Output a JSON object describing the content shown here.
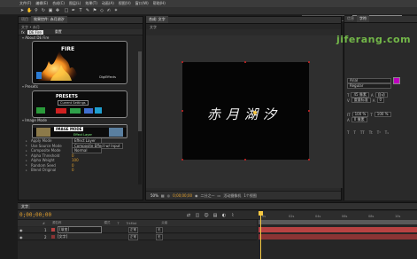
{
  "menubar": {
    "items": [
      "文件(F)",
      "编辑(E)",
      "合成(C)",
      "图层(L)",
      "效果(T)",
      "动画(A)",
      "视图(V)",
      "窗口(W)",
      "帮助(H)"
    ]
  },
  "toolbar": {
    "workspace_label": "工作区:",
    "workspace_value": "标准",
    "search_placeholder": "搜索帮助"
  },
  "left_panel": {
    "tabs": [
      "项目",
      "效果控件: 赤月湖汐"
    ],
    "breadcrumb": "文字 • 赤月",
    "effect_name": "DE Fire",
    "reset_label": "重置",
    "about_label": "About DE Fire",
    "fire_logo": {
      "title": "FIRE",
      "subtitle": "DigiEffects"
    },
    "presets_label": "Presets",
    "presets_logo": {
      "title": "PRESETS",
      "subtitle": "Current Settings"
    },
    "image_mode_label": "Image Mode",
    "image_mode_logo": {
      "title": "IMAGE MODE",
      "subtitle": "Effect Layer"
    },
    "properties": [
      {
        "name": "Apply Mode",
        "value": "Effect Layer",
        "kind": "select"
      },
      {
        "name": "Use Source Mode",
        "value": "Composite Effect w/ Input",
        "kind": "select"
      },
      {
        "name": "Composite Mode",
        "value": "Normal",
        "kind": "select"
      },
      {
        "name": "Alpha Threshold",
        "value": "0",
        "kind": "value"
      },
      {
        "name": "Alpha Weight",
        "value": "100",
        "kind": "value"
      },
      {
        "name": "Random Seed",
        "value": "0",
        "kind": "value"
      },
      {
        "name": "Blend Original",
        "value": "0",
        "kind": "value"
      }
    ]
  },
  "comp_panel": {
    "tabs": [
      "合成: 文字"
    ],
    "subtab": "文字",
    "canvas_text": "赤月湖汐",
    "footer": {
      "zoom": "50%",
      "time": "0;00;00;00",
      "resolution": "二分之一",
      "camera": "活动摄像机",
      "view": "1个视图"
    }
  },
  "right_panel": {
    "tabs": [
      "信息",
      "字符"
    ],
    "watermark": "jiferang.com",
    "font_value": "Arial",
    "style_value": "Regular",
    "accent_color": "#c000c0",
    "sizes": [
      "45 像素",
      "自动",
      "度量标准",
      "0"
    ],
    "scale_values": [
      "100 %",
      "100 %"
    ],
    "shift_value": "0 像素"
  },
  "timeline": {
    "tabs": [
      "文字"
    ],
    "timecode": "0;00;00;00",
    "column_labels": [
      "#",
      "源名称",
      "模式",
      "T",
      "TrkMat",
      "父级"
    ],
    "ruler_ticks": [
      "0s",
      "02s",
      "04s",
      "06s",
      "08s",
      "10s"
    ],
    "layers": [
      {
        "num": "1",
        "name": "[渐变]",
        "mode": "正常",
        "parent": "无"
      },
      {
        "num": "2",
        "name": "[文字]",
        "mode": "正常",
        "parent": "无"
      }
    ]
  },
  "colors": {
    "timecode": "#e3a02d",
    "layer1": "#b84242",
    "layer2": "#8a3434",
    "cti": "#f5c842"
  }
}
